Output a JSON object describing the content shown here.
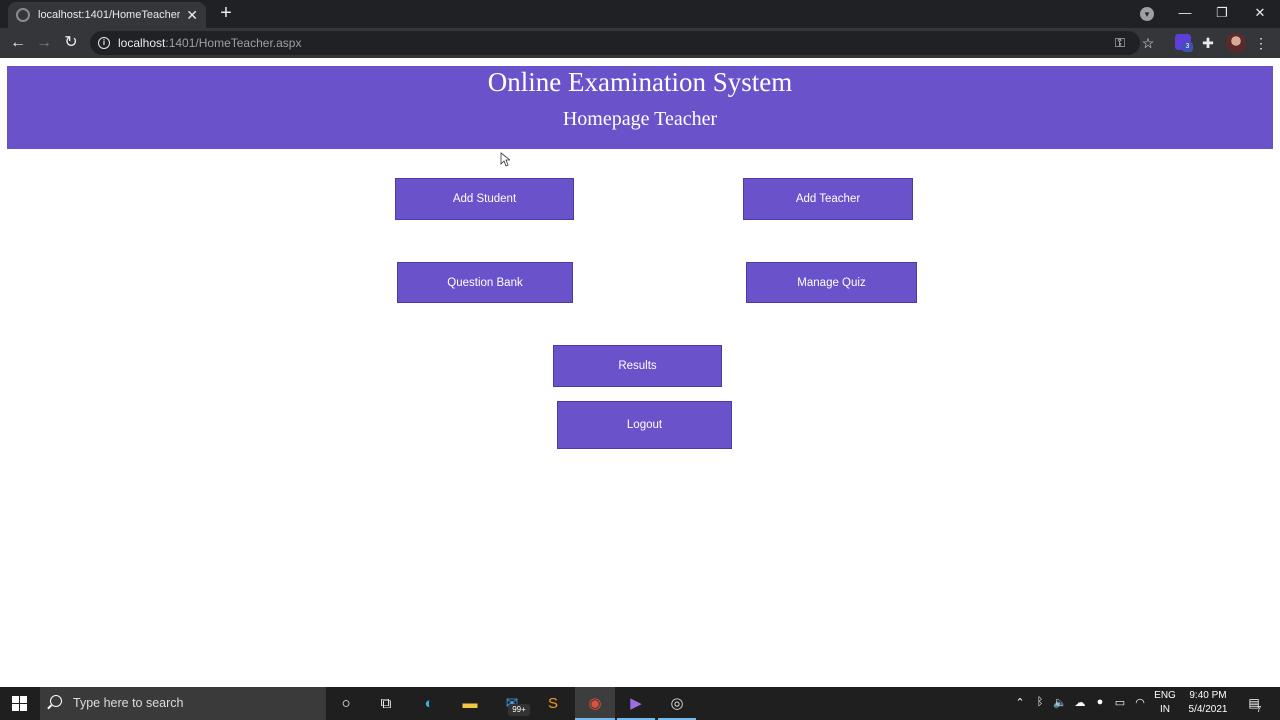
{
  "browser": {
    "tab_title": "localhost:1401/HomeTeacher.aspx",
    "url_host": "localhost",
    "url_rest": ":1401/HomeTeacher.aspx",
    "extension_badge": "3"
  },
  "page": {
    "header_title": "Online Examination System",
    "header_subtitle": "Homepage Teacher",
    "buttons": {
      "add_student": "Add Student",
      "add_teacher": "Add Teacher",
      "question_bank": "Question Bank",
      "manage_quiz": "Manage Quiz",
      "results": "Results",
      "logout": "Logout"
    },
    "accent_color": "#6a52cb"
  },
  "taskbar": {
    "search_placeholder": "Type here to search",
    "mail_badge": "99+",
    "lang_line1": "ENG",
    "lang_line2": "IN",
    "time": "9:40 PM",
    "date": "5/4/2021",
    "notification_count": "7"
  }
}
